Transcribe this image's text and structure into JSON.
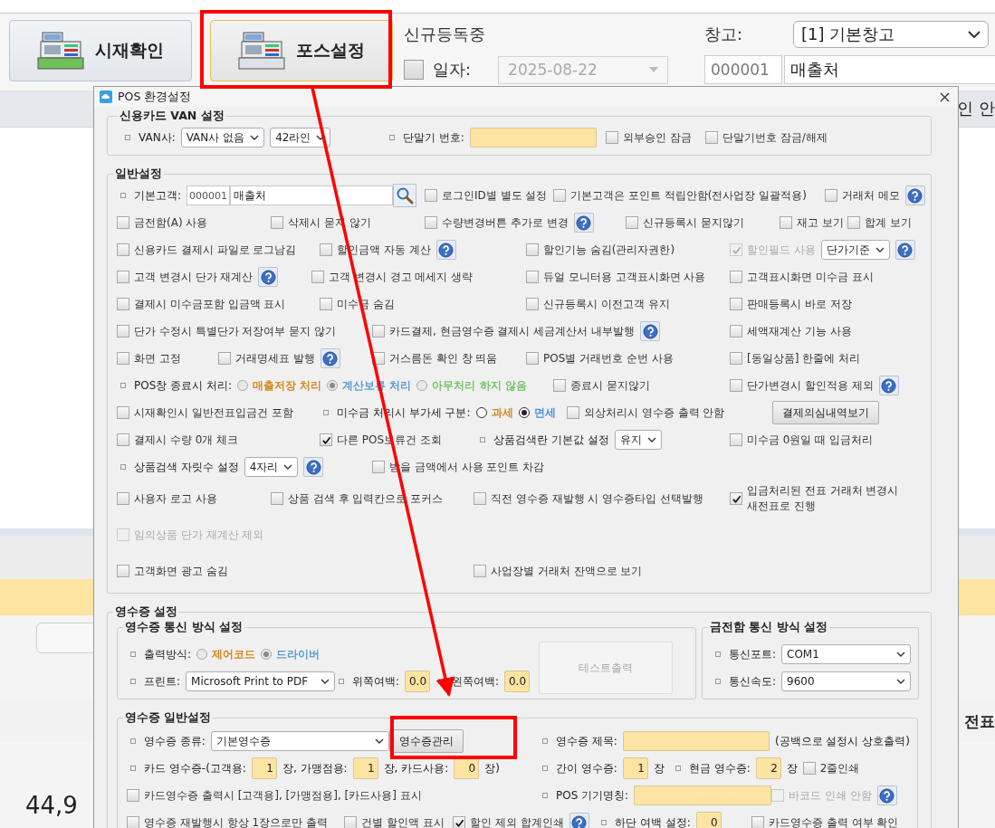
{
  "toolbar": {
    "buttons": [
      {
        "label": "시재확인",
        "selected": false
      },
      {
        "label": "포스설정",
        "selected": true
      }
    ],
    "status": "신규등독중",
    "date": {
      "label": "일자:",
      "checked": false,
      "disabled": true,
      "value": "2025-08-22"
    },
    "warehouse": {
      "label": "창고:",
      "value": "[1] 기본창고"
    },
    "customer": {
      "code": "000001",
      "name": "매출처"
    }
  },
  "background": {
    "texts": [
      "인 안",
      "전표",
      "44,9"
    ]
  },
  "dialog": {
    "title": "POS 환경설정",
    "van": {
      "title": "신용카드 VAN 설정",
      "rows": [
        {
          "cells": [
            [
              {
                "kind": "label",
                "text": "VAN사:"
              },
              {
                "kind": "select",
                "value": "VAN사 없음"
              },
              {
                "kind": "select",
                "value": "42라인"
              }
            ],
            [
              {
                "kind": "label",
                "text": "단말기 번호:"
              },
              {
                "kind": "field"
              }
            ],
            [
              {
                "kind": "checkbox",
                "label": "외부승인 잠금",
                "checked": false,
                "disabled": false
              }
            ],
            [
              {
                "kind": "checkbox",
                "label": "단말기번호 잠금/해제",
                "checked": false,
                "disabled": false
              }
            ]
          ]
        }
      ]
    },
    "general": {
      "title": "일반설정",
      "rows": [
        {
          "cells": [
            [
              {
                "kind": "label",
                "text": "기본고객:"
              },
              {
                "kind": "code",
                "value": "000001"
              },
              {
                "kind": "input",
                "value": "매출처"
              },
              {
                "kind": "search"
              }
            ],
            [
              {
                "kind": "checkbox",
                "label": "로그인ID별 별도 설정",
                "checked": false,
                "disabled": false
              }
            ],
            [
              {
                "kind": "checkbox",
                "label": "기본고객은 포인트 적립안함(전사업장 일괄적용)",
                "checked": false,
                "disabled": false
              }
            ],
            [
              {
                "kind": "checkbox",
                "label": "거래처 메모",
                "checked": false,
                "disabled": false
              },
              {
                "kind": "help"
              }
            ]
          ]
        },
        {
          "cells": [
            [
              {
                "kind": "checkbox",
                "label": "금전함(A) 사용",
                "checked": false,
                "disabled": false
              }
            ],
            [
              {
                "kind": "checkbox",
                "label": "삭제시 묻지 않기",
                "checked": false,
                "disabled": false
              }
            ],
            [
              {
                "kind": "checkbox",
                "label": "수량변경버튼 추가로 변경",
                "checked": false,
                "disabled": false
              },
              {
                "kind": "help"
              }
            ],
            [
              {
                "kind": "checkbox",
                "label": "신규등록시 묻지않기",
                "checked": false,
                "disabled": false
              }
            ],
            [
              {
                "kind": "checkbox",
                "label": "재고 보기",
                "checked": false,
                "disabled": false
              }
            ],
            [
              {
                "kind": "checkbox",
                "label": "합계 보기",
                "checked": false,
                "disabled": false
              }
            ]
          ]
        },
        {
          "cells": [
            [
              {
                "kind": "checkbox",
                "label": "신용카드 결제시 파일로 로그남김",
                "checked": false,
                "disabled": false
              }
            ],
            [
              {
                "kind": "checkbox",
                "label": "할인금액 자동 계산",
                "checked": false,
                "disabled": false
              },
              {
                "kind": "help"
              }
            ],
            [
              {
                "kind": "checkbox",
                "label": "할인기능 숨김(관리자권한)",
                "checked": false,
                "disabled": false
              }
            ],
            [
              {
                "kind": "checkbox",
                "label": "할인필드 사용",
                "checked": true,
                "disabled": true
              },
              {
                "kind": "select",
                "value": "단가기준"
              },
              {
                "kind": "help"
              }
            ]
          ]
        },
        {
          "cells": [
            [
              {
                "kind": "checkbox",
                "label": "고객 변경시 단가 재계산",
                "checked": false,
                "disabled": false
              },
              {
                "kind": "help"
              }
            ],
            [
              {
                "kind": "checkbox",
                "label": "고객 변경시 경고 메세지 생략",
                "checked": false,
                "disabled": false
              }
            ],
            [
              {
                "kind": "checkbox",
                "label": "듀얼 모니터용 고객표시화면 사용",
                "checked": false,
                "disabled": false
              }
            ],
            [
              {
                "kind": "checkbox",
                "label": "고객표시화면 미수금 표시",
                "checked": false,
                "disabled": false
              }
            ]
          ]
        },
        {
          "cells": [
            [
              {
                "kind": "checkbox",
                "label": "결제시 미수금포함 입금액 표시",
                "checked": false,
                "disabled": false
              }
            ],
            [
              {
                "kind": "checkbox",
                "label": "미수금 숨김",
                "checked": false,
                "disabled": false
              }
            ],
            [
              {
                "kind": "checkbox",
                "label": "신규등록시 이전고객 유지",
                "checked": false,
                "disabled": false
              }
            ],
            [
              {
                "kind": "checkbox",
                "label": "판매등록시 바로 저장",
                "checked": false,
                "disabled": false
              }
            ]
          ]
        },
        {
          "cells": [
            [
              {
                "kind": "checkbox",
                "label": "단가 수정시 특별단가 저장여부 묻지 않기",
                "checked": false,
                "disabled": false
              }
            ],
            [
              {
                "kind": "checkbox",
                "label": "카드결제, 현금영수증 결제시 세금계산서 내부발행",
                "checked": false,
                "disabled": false
              },
              {
                "kind": "help"
              }
            ],
            [
              {
                "kind": "checkbox",
                "label": "세액재계산 기능 사용",
                "checked": false,
                "disabled": false
              }
            ]
          ]
        },
        {
          "cells": [
            [
              {
                "kind": "checkbox",
                "label": "화면 고정",
                "checked": false,
                "disabled": false
              }
            ],
            [
              {
                "kind": "checkbox",
                "label": "거래명세표 발행",
                "checked": false,
                "disabled": false
              },
              {
                "kind": "help"
              }
            ],
            [
              {
                "kind": "checkbox",
                "label": "거스름돈 확인 창 띄움",
                "checked": false,
                "disabled": false
              }
            ],
            [
              {
                "kind": "checkbox",
                "label": "POS별 거래번호 순번 사용",
                "checked": false,
                "disabled": false
              }
            ],
            [
              {
                "kind": "checkbox",
                "label": "[동일상품] 한줄에 처리",
                "checked": false,
                "disabled": false
              }
            ]
          ]
        },
        {
          "cells": [
            [
              {
                "kind": "label",
                "text": "POS창 종료시 처리:"
              },
              {
                "kind": "radio",
                "label": "매출저장 처리",
                "selected": false,
                "disabled": true,
                "color": "#d4891f"
              },
              {
                "kind": "radio",
                "label": "계산보류 처리",
                "selected": true,
                "disabled": true,
                "color": "#5b9bd5"
              },
              {
                "kind": "radio",
                "label": "아무처리 하지 않음",
                "selected": false,
                "disabled": true,
                "color": "#79c36a"
              }
            ],
            [
              {
                "kind": "checkbox",
                "label": "종료시 묻지않기",
                "checked": false,
                "disabled": false
              }
            ],
            [
              {
                "kind": "checkbox",
                "label": "단가변경시 할인적용 제외",
                "checked": false,
                "disabled": false
              },
              {
                "kind": "help"
              }
            ]
          ]
        },
        {
          "cells": [
            [
              {
                "kind": "checkbox",
                "label": "시재확인시 일반전표입금건 포함",
                "checked": false,
                "disabled": false
              }
            ],
            [
              {
                "kind": "label",
                "text": "미수금 처리시 부가세 구분:"
              },
              {
                "kind": "radio",
                "label": "과세",
                "selected": false,
                "disabled": false,
                "color": "#d4891f"
              },
              {
                "kind": "radio",
                "label": "면세",
                "selected": true,
                "disabled": false,
                "color": "#4a90d9"
              }
            ],
            [
              {
                "kind": "checkbox",
                "label": "외상처리시 영수증 출력 안함",
                "checked": false,
                "disabled": false
              }
            ],
            [
              {
                "kind": "button",
                "label": "결제의심내역보기",
                "disabled": false
              }
            ]
          ]
        },
        {
          "cells": [
            [
              {
                "kind": "checkbox",
                "label": "결제시 수량 0개 체크",
                "checked": false,
                "disabled": false
              }
            ],
            [
              {
                "kind": "checkbox",
                "label": "다른 POS보류건 조회",
                "checked": true,
                "disabled": false
              }
            ],
            [
              {
                "kind": "label",
                "text": "상품검색란 기본값 설정"
              },
              {
                "kind": "select",
                "value": "유지"
              }
            ],
            [
              {
                "kind": "checkbox",
                "label": "미수금 0원일 때 입금처리",
                "checked": false,
                "disabled": false
              }
            ]
          ]
        },
        {
          "cells": [
            [
              {
                "kind": "label",
                "text": "상품검색 자릿수 설정"
              },
              {
                "kind": "select",
                "value": "4자리"
              },
              {
                "kind": "help"
              }
            ],
            [
              {
                "kind": "checkbox",
                "label": "받을 금액에서 사용 포인트 차감",
                "checked": false,
                "disabled": false
              }
            ]
          ]
        },
        {
          "cells": [
            [
              {
                "kind": "checkbox",
                "label": "사용자 로고 사용",
                "checked": false,
                "disabled": false
              }
            ],
            [
              {
                "kind": "checkbox",
                "label": "상품 검색 후 입력칸으로 포커스",
                "checked": false,
                "disabled": false
              }
            ],
            [
              {
                "kind": "checkbox",
                "label": "직전 영수증 재발행 시 영수증타입 선택발행",
                "checked": false,
                "disabled": false
              }
            ],
            [
              {
                "kind": "checkbox",
                "label": "입금처리된 전표 거래처 변경시 새전표로 진행",
                "checked": true,
                "disabled": false
              }
            ]
          ]
        },
        {
          "cells": [
            [
              {
                "kind": "checkbox",
                "label": "임의상품 단가 재계산 제외",
                "checked": false,
                "disabled": true
              }
            ]
          ]
        },
        {
          "cells": [
            [
              {
                "kind": "checkbox",
                "label": "고객화면 광고 숨김",
                "checked": false,
                "disabled": false
              }
            ],
            [
              {
                "kind": "checkbox",
                "label": "사업장별 거래처 잔액으로 보기",
                "checked": false,
                "disabled": false
              }
            ]
          ]
        }
      ]
    },
    "receipt": {
      "title": "영수증 설정",
      "comm": {
        "title": "영수증 통신 방식 설정",
        "rows": [
          {
            "cells": [
              [
                {
                  "kind": "label",
                  "text": "출력방식:"
                },
                {
                  "kind": "radio",
                  "label": "제어코드",
                  "selected": false,
                  "disabled": true,
                  "color": "#d4891f"
                },
                {
                  "kind": "radio",
                  "label": "드라이버",
                  "selected": true,
                  "disabled": true,
                  "color": "#5b9bd5"
                }
              ]
            ]
          },
          {
            "cells": [
              [
                {
                  "kind": "label",
                  "text": "프린트:"
                },
                {
                  "kind": "select",
                  "value": "Microsoft Print to PDF"
                }
              ],
              [
                {
                  "kind": "label",
                  "text": "위쪽여백:"
                },
                {
                  "kind": "number",
                  "value": "0.0"
                }
              ],
              [
                {
                  "kind": "label",
                  "text": "왼쪽여백:"
                },
                {
                  "kind": "number",
                  "value": "0.0"
                }
              ]
            ]
          }
        ],
        "side_button": {
          "label": "테스트출력",
          "disabled": true
        }
      },
      "drawer": {
        "title": "금전함 통신 방식 설정",
        "rows": [
          {
            "cells": [
              [
                {
                  "kind": "label",
                  "text": "통신포트:"
                },
                {
                  "kind": "select",
                  "value": "COM1"
                }
              ]
            ]
          },
          {
            "cells": [
              [
                {
                  "kind": "label",
                  "text": "통신속도:"
                },
                {
                  "kind": "select",
                  "value": "9600"
                }
              ]
            ]
          }
        ]
      },
      "general": {
        "title": "영수증 일반설정",
        "rows": [
          {
            "cells": [
              [
                {
                  "kind": "label",
                  "text": "영수증 종류:"
                },
                {
                  "kind": "select",
                  "value": "기본영수증"
                }
              ],
              [
                {
                  "kind": "button",
                  "label": "영수증관리",
                  "disabled": false
                }
              ],
              [
                {
                  "kind": "label",
                  "text": "영수증 제목:"
                },
                {
                  "kind": "field"
                },
                {
                  "kind": "text",
                  "text": "(공백으로 설정시 상호출력)"
                }
              ]
            ]
          },
          {
            "cells": [
              [
                {
                  "kind": "label",
                  "text": "카드 영수증-(고객용:"
                },
                {
                  "kind": "number",
                  "value": "1"
                },
                {
                  "kind": "text",
                  "text": "장, 가맹점용:"
                },
                {
                  "kind": "number",
                  "value": "1"
                },
                {
                  "kind": "text",
                  "text": "장, 카드사용:"
                },
                {
                  "kind": "number",
                  "value": "0"
                },
                {
                  "kind": "text",
                  "text": "장)"
                }
              ],
              [
                {
                  "kind": "label",
                  "text": "간이 영수증:"
                },
                {
                  "kind": "number",
                  "value": "1"
                },
                {
                  "kind": "text",
                  "text": "장"
                }
              ],
              [
                {
                  "kind": "label",
                  "text": "현금 영수증:"
                },
                {
                  "kind": "number",
                  "value": "2"
                },
                {
                  "kind": "text",
                  "text": "장"
                },
                {
                  "kind": "checkbox",
                  "label": "2줄인쇄",
                  "checked": false,
                  "disabled": false
                }
              ]
            ]
          },
          {
            "cells": [
              [
                {
                  "kind": "checkbox",
                  "label": "카드영수증 출력시 [고객용], [가맹점용], [카드사용] 표시",
                  "checked": false,
                  "disabled": false
                }
              ],
              [
                {
                  "kind": "label",
                  "text": "POS 기기명칭:"
                },
                {
                  "kind": "field"
                }
              ],
              [
                {
                  "kind": "checkbox",
                  "label": "바코드 인쇄 안함",
                  "checked": false,
                  "disabled": true
                },
                {
                  "kind": "help"
                }
              ]
            ]
          },
          {
            "cells": [
              [
                {
                  "kind": "checkbox",
                  "label": "영수증 재발행시 항상 1장으로만 출력",
                  "checked": false,
                  "disabled": false
                }
              ],
              [
                {
                  "kind": "checkbox",
                  "label": "건별 할인액 표시",
                  "checked": false,
                  "disabled": false
                }
              ],
              [
                {
                  "kind": "checkbox",
                  "label": "할인 제외 합계인쇄",
                  "checked": true,
                  "disabled": false
                },
                {
                  "kind": "help"
                }
              ],
              [
                {
                  "kind": "label",
                  "text": "하단 여백 설정:"
                },
                {
                  "kind": "number",
                  "value": "0"
                }
              ],
              [
                {
                  "kind": "checkbox",
                  "label": "카드영수증 출력 여부 확인",
                  "checked": false,
                  "disabled": false
                }
              ]
            ]
          }
        ]
      }
    }
  }
}
